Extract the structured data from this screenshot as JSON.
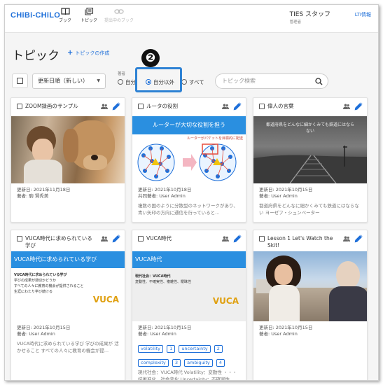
{
  "header": {
    "logo": "CHiBi-CHiLO",
    "nav": [
      {
        "label": "ブック",
        "icon": "book-icon"
      },
      {
        "label": "トピック",
        "icon": "topic-icon"
      },
      {
        "label": "提出中のブック",
        "icon": "link-icon"
      }
    ],
    "user_name": "TIES スタッフ",
    "user_role": "管理者",
    "lti_link": "LTI情報"
  },
  "page": {
    "title": "トピック",
    "create_label": "トピックの作成",
    "callout": "❷"
  },
  "toolbar": {
    "sort_value": "更新日順（新しい）",
    "filter_label": "著者",
    "filter_options": [
      "自分",
      "自分以外",
      "すべて"
    ],
    "search_placeholder": "トピック検索"
  },
  "cards": [
    {
      "title": "ZOOM録画のサンプル",
      "updated": "更新日: 2021年11月18日",
      "author": "著者: 駒 賢秀美"
    },
    {
      "title": "ルータの役割",
      "thumb_text": "ルーターが大切な役割を担う",
      "thumb_sub": "ルーターがパケットを目標的に配送",
      "updated": "更新日: 2021年10月18日",
      "author": "共同著者: User Admin",
      "desc": "複数の国のように分散型のネットワークがあり、青い矢印の方向に通信を行っていると..."
    },
    {
      "title": "偉人の言葉",
      "thumb_text": "都道府県をどんなに細かくみても鉄道にはならない",
      "updated": "更新日: 2021年10月15日",
      "author": "著者: User Admin",
      "desc": "都道府県をどんなに細かくみても鉄道にはならない ヨーゼフ・シュンペーター"
    },
    {
      "title": "VUCA時代に求められている学び",
      "thumb_text": "VUCA時代に求められている学び",
      "thumb_lines": [
        "VUCA時代に求められている学び",
        "学びの成果が適切かどうか",
        "すべての人々に教育の機会が提供されること",
        "生涯にわたり学び続ける"
      ],
      "vuca": "VUCA",
      "updated": "更新日: 2021年10月15日",
      "author": "著者: User Admin",
      "desc": "VUCA時代に求められている学び 学びの成果が 活かせること すべての人々に教育の機会が提..."
    },
    {
      "title": "VUCA時代",
      "thumb_text": "VUCA時代",
      "thumb_lines": [
        "現代社会：VUCA時代",
        "変動性、不確実性、複雑性、曖昧性"
      ],
      "vuca": "VUCA",
      "updated": "更新日: 2021年10月15日",
      "author": "著者: User Admin",
      "tags": [
        [
          "volatility",
          "1",
          "uncertainty",
          "2"
        ],
        [
          "complexity",
          "3",
          "ambiguity",
          "4"
        ]
      ],
      "desc": "現代社会：VUCA時代 Volatility：変動性 ・・・技術進化、社会変化 Uncertainty：不確実性 ・・・"
    },
    {
      "title": "Lesson 1 Let's Watch the Skit!",
      "updated": "更新日: 2021年10月15日",
      "author": "著者: User Admin"
    }
  ]
}
